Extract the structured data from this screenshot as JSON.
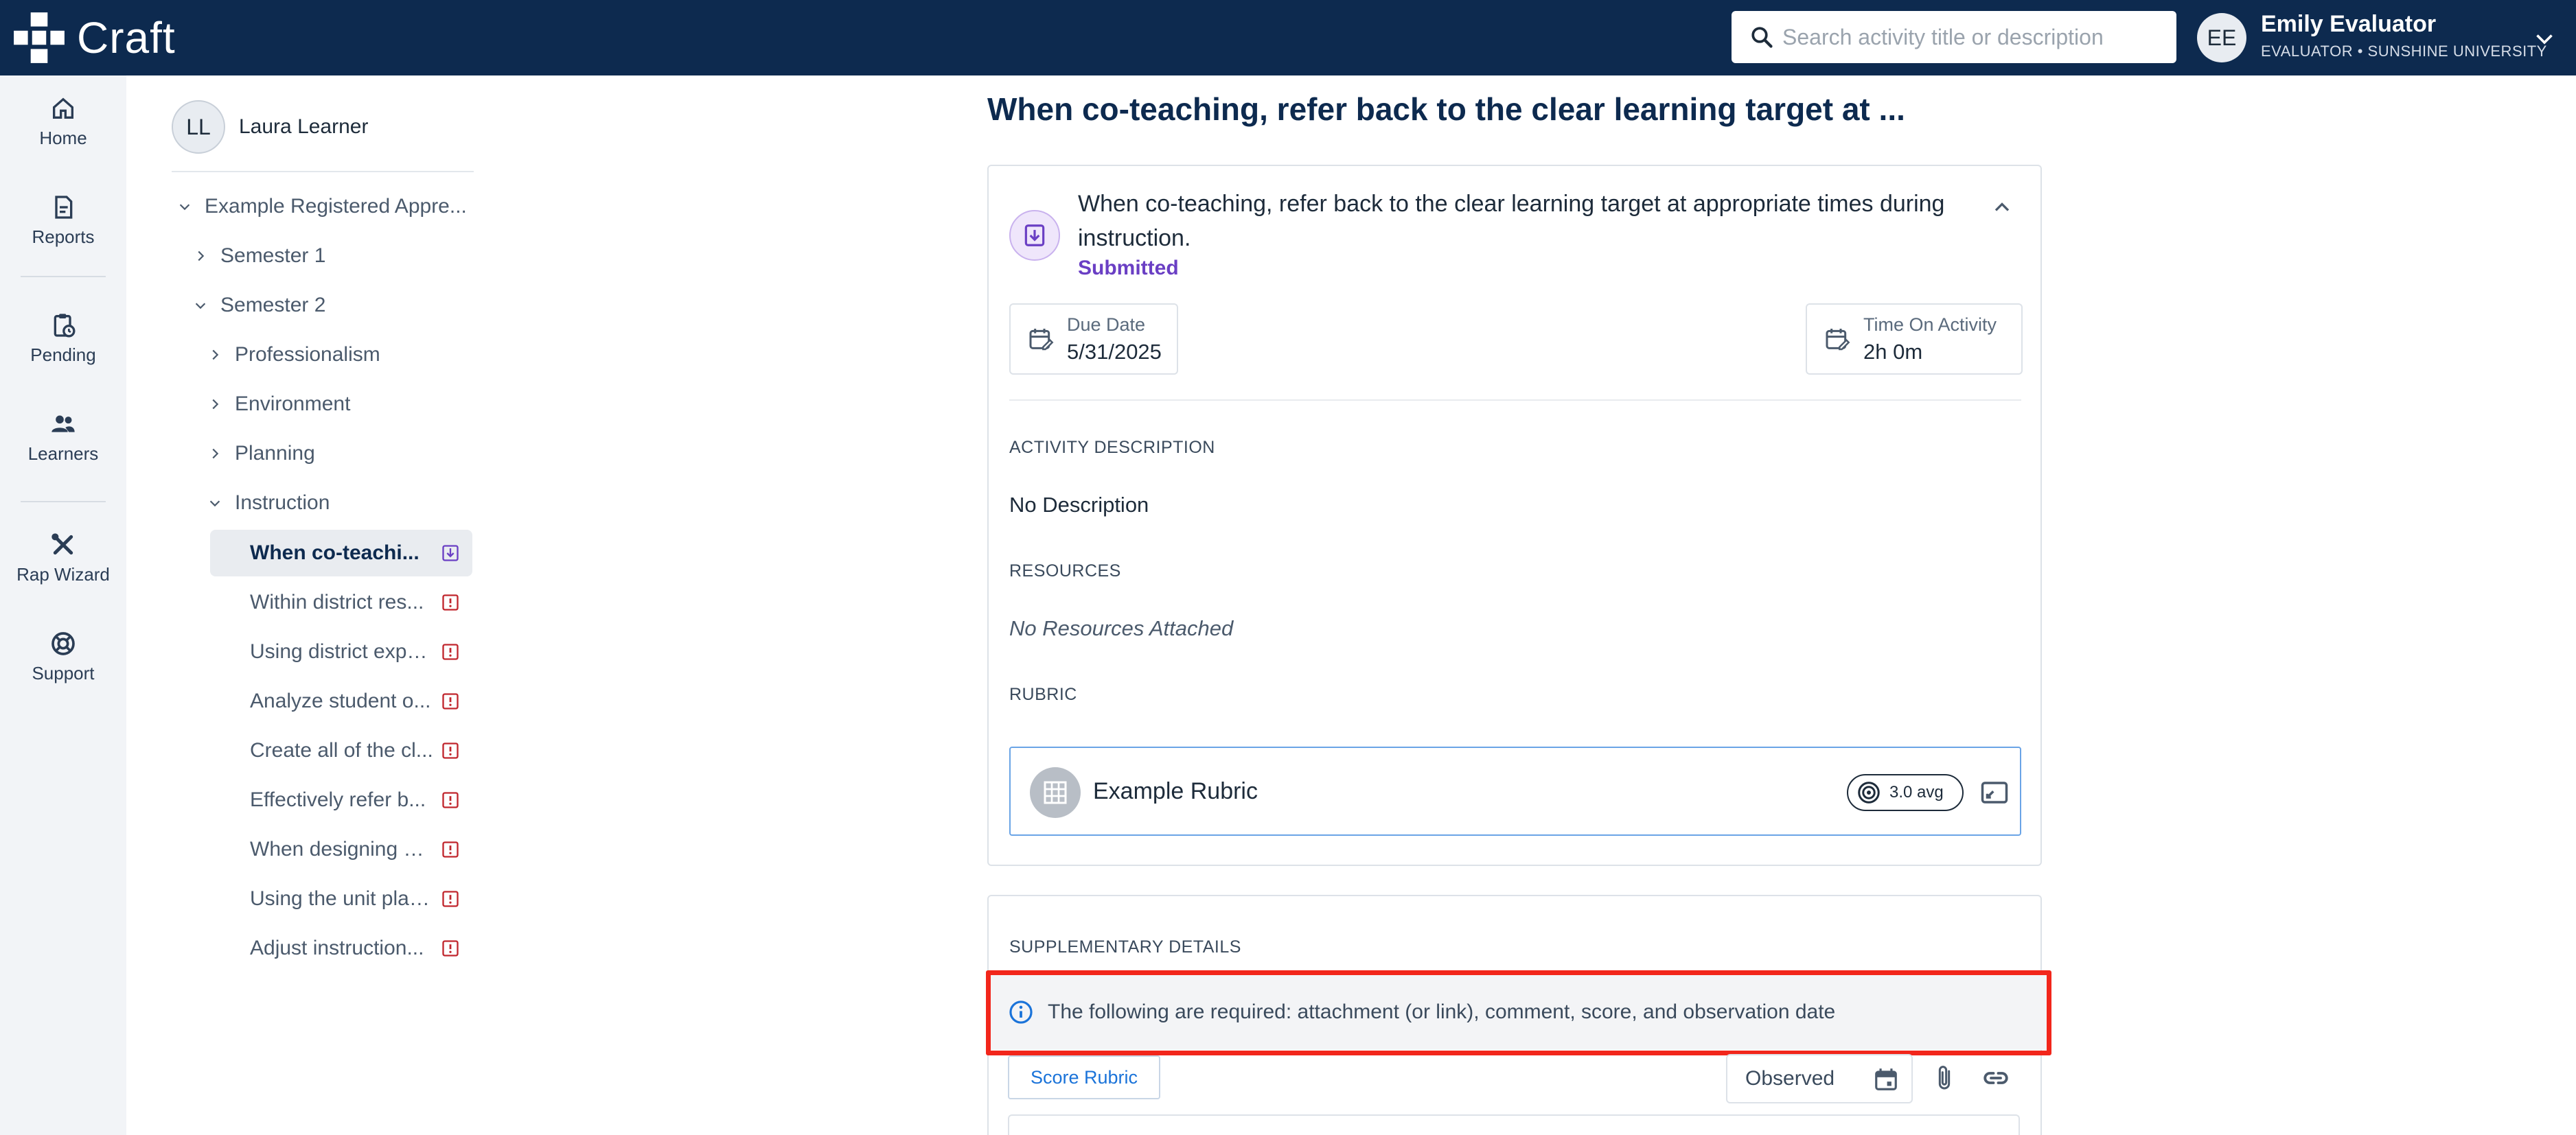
{
  "app": {
    "logo_text": "Craft",
    "brand_color": "#0d2a4f"
  },
  "search": {
    "placeholder": "Search activity title or description",
    "icon": "search-icon"
  },
  "user": {
    "initials": "EE",
    "name": "Emily Evaluator",
    "role": "EVALUATOR • SUNSHINE UNIVERSITY"
  },
  "rail": {
    "items": [
      {
        "label": "Home",
        "icon": "home-icon"
      },
      {
        "label": "Reports",
        "icon": "reports-icon"
      },
      {
        "label": "Pending",
        "icon": "pending-icon"
      },
      {
        "label": "Learners",
        "icon": "learners-icon"
      },
      {
        "label": "Rap Wizard",
        "icon": "tools-icon"
      },
      {
        "label": "Support",
        "icon": "support-icon"
      }
    ]
  },
  "learner": {
    "initials": "LL",
    "name": "Laura Learner"
  },
  "tree": {
    "program": "Example Registered Appre...",
    "semester1": "Semester 1",
    "semester2": "Semester 2",
    "categories": [
      "Professionalism",
      "Environment",
      "Planning",
      "Instruction"
    ],
    "activities": [
      {
        "label": "When co-teachi...",
        "status": "submitted",
        "active": true
      },
      {
        "label": "Within district res...",
        "status": "required"
      },
      {
        "label": "Using district expe...",
        "status": "required"
      },
      {
        "label": "Analyze student o...",
        "status": "required"
      },
      {
        "label": "Create all of the cl...",
        "status": "required"
      },
      {
        "label": "Effectively refer b...",
        "status": "required"
      },
      {
        "label": "When designing a ...",
        "status": "required"
      },
      {
        "label": "Using the unit plan...",
        "status": "required"
      },
      {
        "label": "Adjust instruction...",
        "status": "required"
      }
    ]
  },
  "main": {
    "page_title": "When co-teaching, refer back to the clear learning target at ...",
    "activity": {
      "title": "When co-teaching, refer back to the clear learning target at appropriate times during instruction.",
      "status": "Submitted",
      "status_color": "#6a3fc4"
    },
    "due_date": {
      "label": "Due Date",
      "value": "5/31/2025"
    },
    "time_on_activity": {
      "label": "Time On Activity",
      "value": "2h 0m"
    },
    "description": {
      "label": "ACTIVITY DESCRIPTION",
      "value": "No Description"
    },
    "resources": {
      "label": "RESOURCES",
      "value": "No Resources Attached"
    },
    "rubric": {
      "label": "RUBRIC",
      "name": "Example Rubric",
      "avg": "3.0 avg"
    },
    "supplementary": {
      "label": "SUPPLEMENTARY DETAILS",
      "notice": "The following are required: attachment (or link), comment, score, and observation date",
      "score_button": "Score Rubric",
      "observed_placeholder": "Observed"
    }
  }
}
